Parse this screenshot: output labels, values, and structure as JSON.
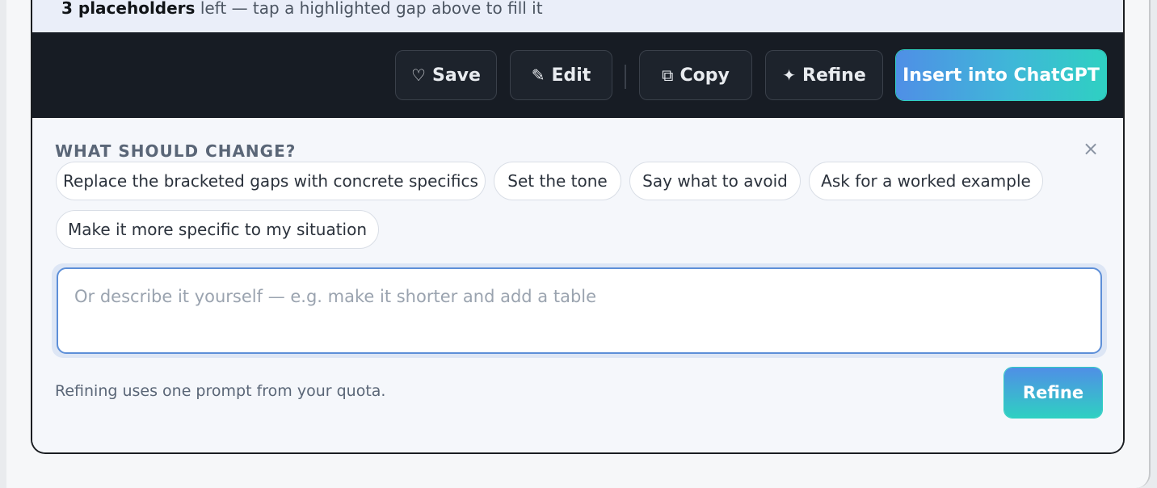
{
  "status": {
    "count_label": "3 placeholders",
    "rest": "left — tap a highlighted gap above to fill it"
  },
  "toolbar": {
    "save": {
      "icon": "♡",
      "label": "Save"
    },
    "edit": {
      "icon": "✎",
      "label": "Edit"
    },
    "copy": {
      "icon": "⧉",
      "label": "Copy"
    },
    "refine": {
      "icon": "✦",
      "label": "Refine"
    },
    "insert_label": "Insert into ChatGPT"
  },
  "refine_panel": {
    "heading": "WHAT SHOULD CHANGE?",
    "close_icon": "×",
    "suggestions": [
      "Replace the bracketed gaps with concrete specifics",
      "Set the tone",
      "Say what to avoid",
      "Ask for a worked example",
      "Make it more specific to my situation"
    ],
    "input_placeholder": "Or describe it yourself — e.g. make it shorter and add a table",
    "input_value": "",
    "quota_note": "Refining uses one prompt from your quota.",
    "submit_label": "Refine"
  },
  "colors": {
    "toolbar_bg": "#171c24",
    "accent_gradient_start": "#4f8fe6",
    "accent_gradient_end": "#2fd0c2",
    "input_focus_border": "#5d8fd8"
  }
}
